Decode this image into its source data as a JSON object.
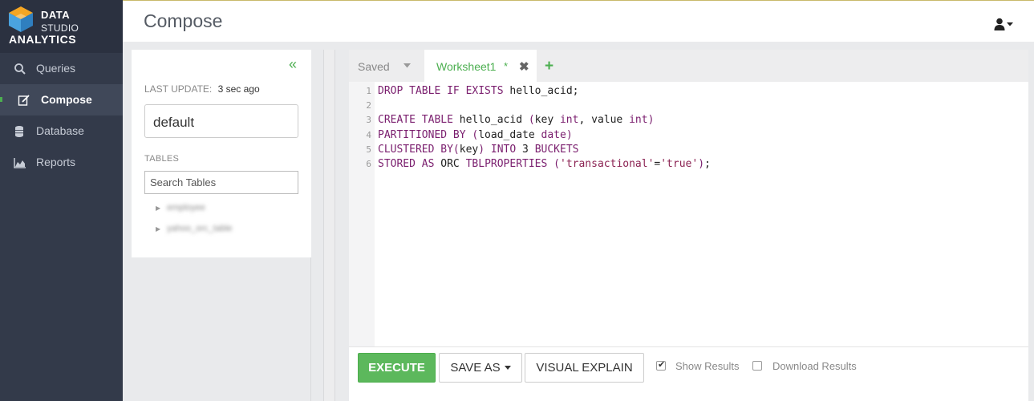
{
  "app": {
    "logo_line1": "DATA",
    "logo_line2": "STUDIO",
    "logo_line3": "ANALYTICS"
  },
  "sidebar": {
    "items": [
      {
        "label": "Queries",
        "icon": "search-icon"
      },
      {
        "label": "Compose",
        "icon": "edit-icon",
        "active": true
      },
      {
        "label": "Database",
        "icon": "database-icon"
      },
      {
        "label": "Reports",
        "icon": "chart-icon"
      }
    ]
  },
  "header": {
    "title": "Compose",
    "user_icon": "user-icon"
  },
  "left_panel": {
    "last_update_label": "LAST UPDATE:",
    "last_update_value": "3 sec ago",
    "database": "default",
    "tables_label": "TABLES",
    "search_placeholder": "Search Tables",
    "tables": [
      "employee",
      "yahoo_orc_table"
    ]
  },
  "editor": {
    "tabs": {
      "saved_label": "Saved",
      "worksheet_label": "Worksheet1",
      "modified_marker": "*"
    },
    "lines": [
      {
        "n": "1",
        "text": "DROP TABLE IF EXISTS hello_acid;"
      },
      {
        "n": "2",
        "text": ""
      },
      {
        "n": "3",
        "text": "CREATE TABLE hello_acid (key int, value int)"
      },
      {
        "n": "4",
        "text": "PARTITIONED BY (load_date date)"
      },
      {
        "n": "5",
        "text": "CLUSTERED BY(key) INTO 3 BUCKETS"
      },
      {
        "n": "6",
        "text": "STORED AS ORC TBLPROPERTIES ('transactional'='true');"
      }
    ]
  },
  "toolbar": {
    "execute_label": "EXECUTE",
    "save_as_label": "SAVE AS",
    "visual_explain_label": "VISUAL EXPLAIN",
    "show_results_label": "Show Results",
    "show_results_checked": true,
    "download_results_label": "Download Results",
    "download_results_checked": false
  },
  "colors": {
    "accent": "#4caf50",
    "sidebar_bg": "#333a4a",
    "execute_bg": "#5cb85c",
    "keyword": "#7a1e6e"
  }
}
